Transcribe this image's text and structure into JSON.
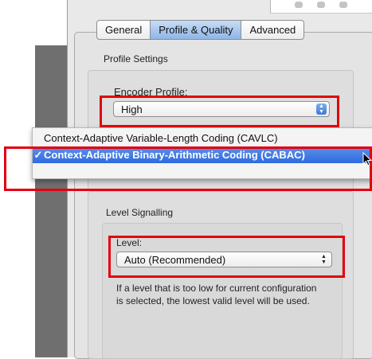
{
  "tabs": [
    {
      "label": "General",
      "selected": false
    },
    {
      "label": "Profile & Quality",
      "selected": true
    },
    {
      "label": "Advanced",
      "selected": false
    }
  ],
  "profile_settings": {
    "group_label": "Profile Settings",
    "encoder_label": "Encoder Profile:",
    "encoder_value": "High"
  },
  "encoder_menu": {
    "items": [
      {
        "label": "Context-Adaptive Variable-Length Coding (CAVLC)",
        "checked": false
      },
      {
        "label": "Context-Adaptive Binary-Arithmetic Coding (CABAC)",
        "checked": true
      }
    ],
    "check_mark": "✓"
  },
  "level_signalling": {
    "group_label": "Level Signalling",
    "level_label": "Level:",
    "level_value": "Auto (Recommended)",
    "help_text": "If a level that is too low for current configuration is selected, the lowest valid level will be used."
  },
  "colors": {
    "annotation": "#e3000f",
    "selection": "#2f6be0"
  },
  "icons": {
    "stepper": "up-down-arrows-icon",
    "cursor": "mouse-pointer-icon"
  }
}
